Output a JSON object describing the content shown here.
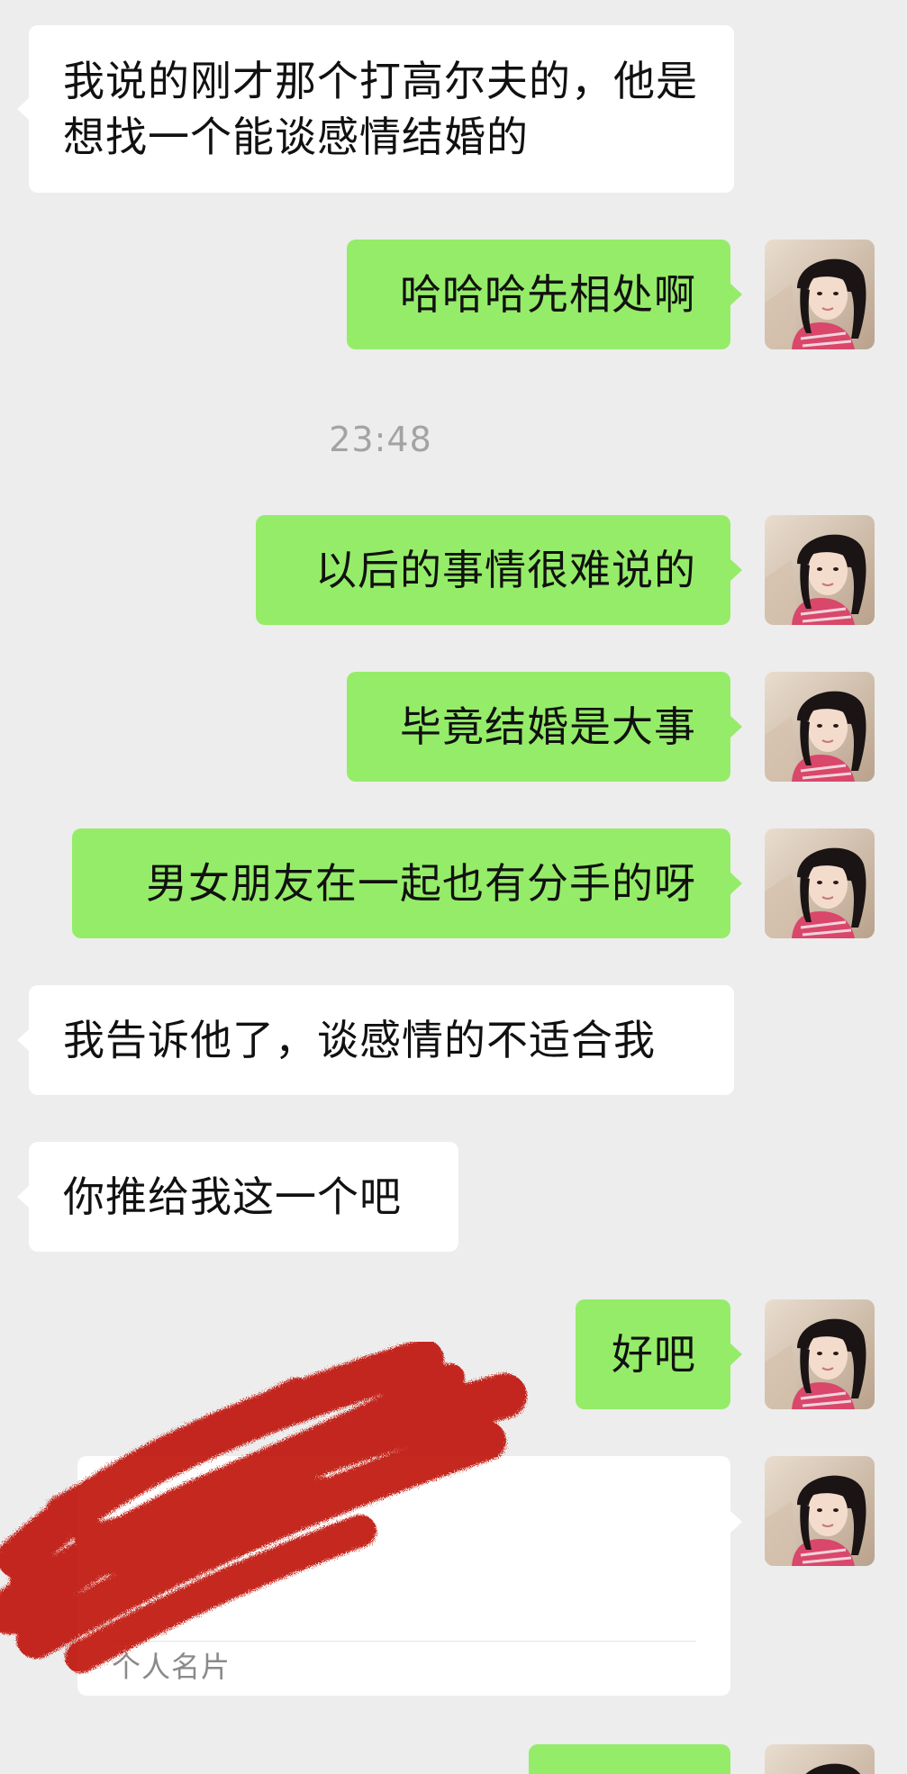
{
  "messages": [
    {
      "side": "in",
      "text": "我说的刚才那个打高尔夫的，他是想找一个能谈感情结婚的"
    },
    {
      "side": "out",
      "text": "哈哈哈先相处啊"
    },
    {
      "side": "out",
      "text": "以后的事情很难说的"
    },
    {
      "side": "out",
      "text": "毕竟结婚是大事"
    },
    {
      "side": "out",
      "text": "男女朋友在一起也有分手的呀"
    },
    {
      "side": "in",
      "text": "我告诉他了，谈感情的不适合我"
    },
    {
      "side": "in",
      "text": "你推给我这一个吧"
    },
    {
      "side": "out",
      "text": "好吧"
    }
  ],
  "timestamp": "23:48",
  "contact_card": {
    "label": "个人名片"
  },
  "colors": {
    "background": "#ededed",
    "outgoing_bubble": "#95ec69",
    "incoming_bubble": "#ffffff",
    "timestamp_text": "#a3a3a3",
    "redaction_scribble": "#c0180c"
  },
  "icons": {
    "avatar": "user-avatar-photo"
  }
}
